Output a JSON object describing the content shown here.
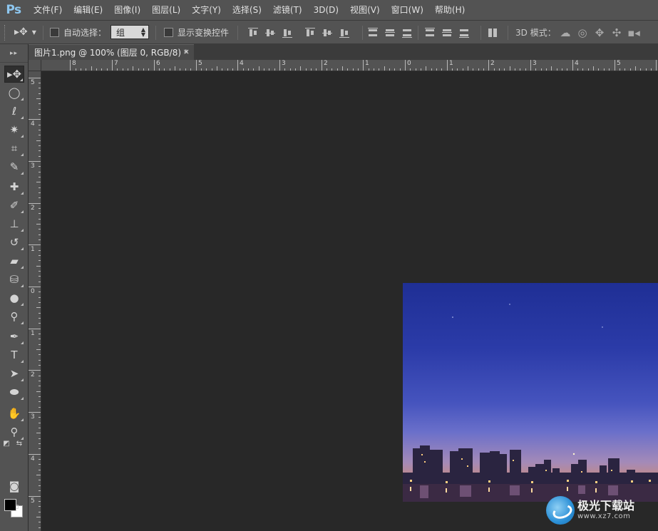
{
  "app": {
    "logo": "Ps"
  },
  "menu": [
    "文件(F)",
    "编辑(E)",
    "图像(I)",
    "图层(L)",
    "文字(Y)",
    "选择(S)",
    "滤镜(T)",
    "3D(D)",
    "视图(V)",
    "窗口(W)",
    "帮助(H)"
  ],
  "options": {
    "auto_select_label": "自动选择：",
    "auto_select_value": "组",
    "show_transform_label": "显示变换控件",
    "mode_3d_label": "3D 模式："
  },
  "document": {
    "tab_title": "图片1.png @ 100% (图层 0, RGB/8) *",
    "close_glyph": "×"
  },
  "ruler": {
    "top_labels": [
      "8",
      "7",
      "6",
      "5",
      "4",
      "3",
      "2",
      "1",
      "0",
      "1",
      "2",
      "3",
      "4",
      "5"
    ],
    "left_labels": [
      "5",
      "4",
      "3",
      "2",
      "1",
      "0",
      "1",
      "2",
      "3",
      "4",
      "5"
    ]
  },
  "tools": [
    {
      "name": "move-tool",
      "icon": "move-icon",
      "glyph": "▸✥",
      "active": true
    },
    {
      "name": "marquee-tool",
      "icon": "elliptical-marquee-icon",
      "glyph": "◯"
    },
    {
      "name": "lasso-tool",
      "icon": "lasso-icon",
      "glyph": "ℓ"
    },
    {
      "name": "magic-wand-tool",
      "icon": "magic-wand-icon",
      "glyph": "✷"
    },
    {
      "name": "crop-tool",
      "icon": "crop-icon",
      "glyph": "⌗"
    },
    {
      "name": "eyedropper-tool",
      "icon": "eyedropper-icon",
      "glyph": "✎"
    },
    {
      "name": "healing-brush-tool",
      "icon": "bandage-icon",
      "glyph": "✚"
    },
    {
      "name": "brush-tool",
      "icon": "brush-icon",
      "glyph": "✐"
    },
    {
      "name": "clone-stamp-tool",
      "icon": "stamp-icon",
      "glyph": "⊥"
    },
    {
      "name": "history-brush-tool",
      "icon": "history-brush-icon",
      "glyph": "↺"
    },
    {
      "name": "eraser-tool",
      "icon": "eraser-icon",
      "glyph": "▰"
    },
    {
      "name": "paint-bucket-tool",
      "icon": "paint-bucket-icon",
      "glyph": "⛁"
    },
    {
      "name": "blur-tool",
      "icon": "blur-drop-icon",
      "glyph": "●"
    },
    {
      "name": "dodge-tool",
      "icon": "dodge-icon",
      "glyph": "⚲"
    },
    {
      "name": "pen-tool",
      "icon": "pen-icon",
      "glyph": "✒"
    },
    {
      "name": "type-tool",
      "icon": "type-icon",
      "glyph": "T"
    },
    {
      "name": "path-selection-tool",
      "icon": "path-selection-icon",
      "glyph": "➤"
    },
    {
      "name": "ellipse-tool",
      "icon": "ellipse-icon",
      "glyph": "⬬"
    },
    {
      "name": "hand-tool",
      "icon": "hand-icon",
      "glyph": "✋"
    },
    {
      "name": "zoom-tool",
      "icon": "zoom-icon",
      "glyph": "⚲"
    }
  ],
  "colors": {
    "foreground": "#000000",
    "background": "#ffffff",
    "ui_panel": "#535353",
    "workspace": "#282828"
  },
  "watermark": {
    "name": "极光下载站",
    "url": "www.xz7.com"
  }
}
